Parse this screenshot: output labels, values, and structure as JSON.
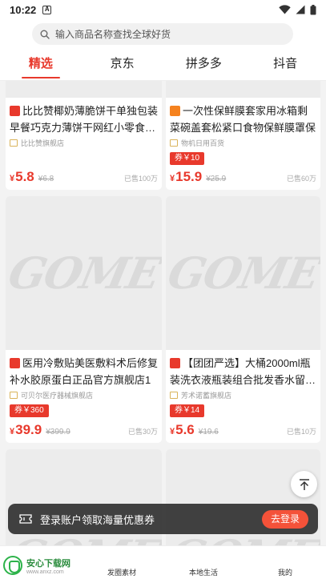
{
  "status_bar": {
    "time": "10:22",
    "notif_letter": "A"
  },
  "search": {
    "placeholder": "输入商品名称查找全球好货"
  },
  "tabs": [
    {
      "label": "精选",
      "active": true
    },
    {
      "label": "京东",
      "active": false
    },
    {
      "label": "拼多多",
      "active": false
    },
    {
      "label": "抖音",
      "active": false
    }
  ],
  "products": [
    {
      "badge": "天猫",
      "badge_kind": "tmall",
      "title": "比比赞椰奶薄脆饼干单独包装早餐巧克力薄饼干网红小零食…",
      "shop": "比比赞旗舰店",
      "coupon": "",
      "price": "5.8",
      "original_price": "¥6.8",
      "sold": "已售100万"
    },
    {
      "badge": "淘",
      "badge_kind": "taobao",
      "title": "一次性保鲜膜套家用冰箱剩菜碗盖套松紧口食物保鲜膜罩保鲜",
      "shop": "物机日用百货",
      "coupon": "券￥10",
      "price": "15.9",
      "original_price": "¥25.9",
      "sold": "已售60万"
    },
    {
      "badge": "天猫",
      "badge_kind": "tmall",
      "title": "医用冷敷贴美医敷料术后修复补水胶原蛋白正品官方旗舰店1",
      "shop": "可贝尔医疗器械旗舰店",
      "coupon": "券￥360",
      "price": "39.9",
      "original_price": "¥399.9",
      "sold": "已售30万"
    },
    {
      "badge": "天猫",
      "badge_kind": "tmall",
      "title": "【团团严选】大桶2000ml瓶装洗衣液瓶装组合批发香水留…",
      "shop": "芳术诺蓄旗舰店",
      "coupon": "券￥14",
      "price": "5.6",
      "original_price": "¥19.6",
      "sold": "已售10万"
    }
  ],
  "placeholder_brand": "GOME",
  "currency_symbol": "¥",
  "login_bar": {
    "text": "登录账户领取海量优惠券",
    "button": "去登录"
  },
  "bottom_nav": {
    "logo_title": "安心下载网",
    "logo_sub": "www.anxz.com",
    "items": [
      "发圈素材",
      "本地生活",
      "我的"
    ]
  },
  "colors": {
    "accent": "#e8392c",
    "login_button": "#f45239",
    "logo_green": "#2db34a"
  }
}
